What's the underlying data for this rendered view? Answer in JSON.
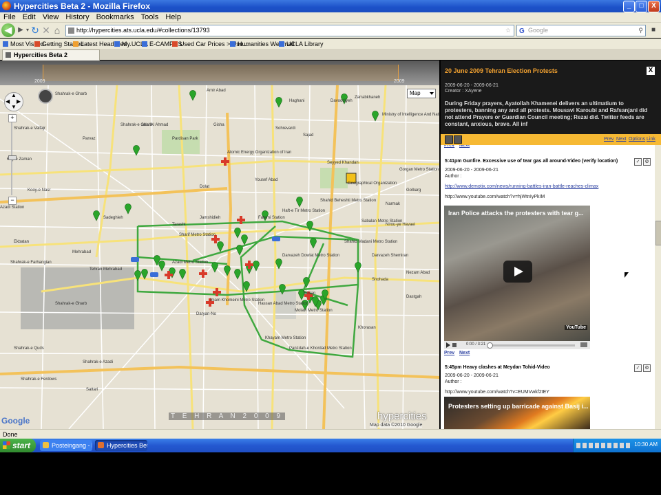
{
  "window": {
    "title": "Hypercities Beta 2 - Mozilla Firefox",
    "min_label": "_",
    "max_label": "□",
    "close_label": "X"
  },
  "menu": [
    "File",
    "Edit",
    "View",
    "History",
    "Bookmarks",
    "Tools",
    "Help"
  ],
  "nav": {
    "url": "http://hypercities.ats.ucla.edu/#collections/13793",
    "search_placeholder": "Google",
    "search_engine": "G"
  },
  "bookmarks": [
    {
      "label": "Most Visited",
      "color": "#3a6ed8"
    },
    {
      "label": "Getting Started",
      "color": "#d84a2a"
    },
    {
      "label": "Latest Headlines",
      "color": "#f0a030"
    },
    {
      "label": "My.UCLA",
      "color": "#3a6ed8"
    },
    {
      "label": "E-CAMPUS",
      "color": "#3a6ed8"
    },
    {
      "label": "Used Car Prices > Use...",
      "color": "#d84a2a"
    },
    {
      "label": "Humanities Webmail",
      "color": "#3a6ed8"
    },
    {
      "label": "UCLA Library",
      "color": "#3a6ed8"
    }
  ],
  "tab": {
    "label": "Hypercities Beta 2"
  },
  "timeline": {
    "start_year": "2009",
    "end_year": "2009"
  },
  "map": {
    "type_label": "Map",
    "caption": "T E H R A N   2 0 0 9",
    "brand": "hypercities",
    "google": "Google",
    "copyright": "Map data ©2010 Google",
    "labels": [
      {
        "t": "Shahrak-e Gharb"
      },
      {
        "t": "Shahrak-e Valfajr"
      },
      {
        "t": "Koy-e Zaman"
      },
      {
        "t": "Parvaz"
      },
      {
        "t": "Pardisan Park"
      },
      {
        "t": "Atomic Energy Organization of Iran"
      },
      {
        "t": "Sharif Metro Station"
      },
      {
        "t": "Jamshidieh"
      },
      {
        "t": "Azadi Metro Station"
      },
      {
        "t": "Azadi Station"
      },
      {
        "t": "Ekbatan"
      },
      {
        "t": "Shahrak-e Farhangian"
      },
      {
        "t": "Shahrak-e Gharb"
      },
      {
        "t": "Mehrabad"
      },
      {
        "t": "Tehran Mehrabad"
      },
      {
        "t": "Darvazeh Dowlat Metro Station"
      },
      {
        "t": "Shahid Madani Metro Station"
      },
      {
        "t": "Sabalan Metro Station"
      },
      {
        "t": "Gorgan Metro Station"
      },
      {
        "t": "Tehran"
      },
      {
        "t": "Hassan Abad Metro Station"
      },
      {
        "t": "Molavi Metro Station"
      },
      {
        "t": "Khayam Metro Station"
      },
      {
        "t": "Panzdah-e Khordad Metro Station"
      },
      {
        "t": "Imam Khomeini Metro Station"
      },
      {
        "t": "Daryan-No"
      },
      {
        "t": "Golbarg"
      },
      {
        "t": "Narmak"
      },
      {
        "t": "Seyyed Khandan"
      },
      {
        "t": "Shahid Beheshti Metro Station"
      },
      {
        "t": "Fatemi Station"
      },
      {
        "t": "Haft-e Tir Metro Station"
      },
      {
        "t": "Yousef Abad"
      },
      {
        "t": "Geographical Organization"
      },
      {
        "t": "Ministry of Intelligence And National Security"
      },
      {
        "t": "Davoodiyeh"
      },
      {
        "t": "Zarrabkhaneh"
      },
      {
        "t": "Jalal Al Ahmad"
      },
      {
        "t": "Sadeghieh"
      },
      {
        "t": "Tarasht"
      },
      {
        "t": "Gisha"
      },
      {
        "t": "Shahrak-e Quds"
      },
      {
        "t": "Shahrak-e Ferdows"
      },
      {
        "t": "Sattari"
      },
      {
        "t": "Shahrak-e Azadi"
      },
      {
        "t": "Kooy-e Nasr"
      },
      {
        "t": "Dastgah"
      },
      {
        "t": "Nezam Abad"
      },
      {
        "t": "Khorasan"
      },
      {
        "t": "Shohada"
      },
      {
        "t": "Darvazeh Shemiran"
      },
      {
        "t": "Nirou-ye Havaei"
      },
      {
        "t": "Shahrak-e Gharb"
      },
      {
        "t": "Amir Abad"
      },
      {
        "t": "Haghani"
      },
      {
        "t": "Sohrevardi"
      },
      {
        "t": "Sajad"
      },
      {
        "t": "Dolat"
      }
    ]
  },
  "panel": {
    "title": "20 June 2009 Tehran Election Protests",
    "close_label": "X",
    "dates": "2009-06-20 - 2009-06-21",
    "creator": "Creator : XAyene",
    "description": "During Friday prayers, Ayatollah Khamenei delivers an ultimatium to protesters, banning any and all protests. Mousavi Karoubi and Rafsanjani did not attend Prayers or Guardian Council meeting; Rezai did. Twitter feeds are constant, anxious, brave. All inf",
    "toolbar_links": [
      "Prev",
      "Next",
      "Options",
      "Link"
    ],
    "prev": "Prev",
    "next": "Next",
    "entries": [
      {
        "title": "5:41pm Gunfire. Excessive use of tear gas all around-Video (verify location)",
        "dates": "2009-06-20 - 2009-06-21",
        "author": "Author :",
        "url1": "http://www.demotix.com/news/running-battles-iran-battle-reaches-climax",
        "url2": "http://www.youtube.com/watch?v=hjWtnIyPkIM",
        "video_title": "Iran  Police attacks the protesters with tear g...",
        "video_time": "0:00 / 3:21",
        "video_logo": "YouTube"
      },
      {
        "title": "5:45pm Heavy clashes at Meydan Tohid-Video",
        "dates": "2009-06-20 - 2009-06-21",
        "author": "Author :",
        "url2": "http://www.youtube.com/watch?v=EUMVwkf2tEY",
        "video_title": "Protesters setting up barricade against Basij i..."
      }
    ]
  },
  "status": {
    "text": "Done"
  },
  "taskbar": {
    "start": "start",
    "tasks": [
      {
        "label": "Posteingang - Mic...",
        "color": "#f0c040"
      },
      {
        "label": "Hypercities Beta 2...",
        "color": "#e07030"
      }
    ],
    "clock": "10:30 AM"
  },
  "colors": {
    "route": "#3fa83f",
    "marker_green": "#2aa52a",
    "marker_red": "#d83a2a",
    "panel_accent": "#f6b934"
  }
}
